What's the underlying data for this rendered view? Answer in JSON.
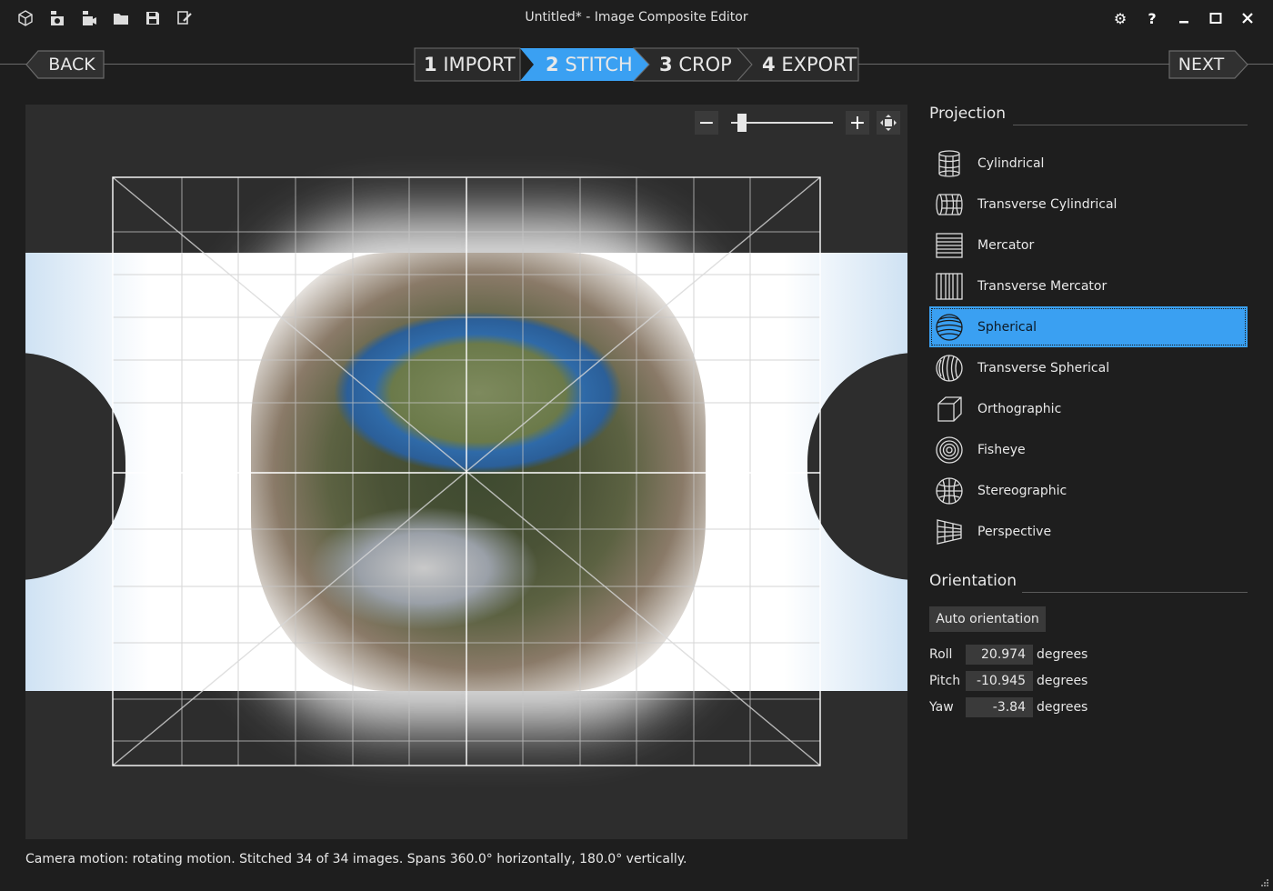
{
  "window": {
    "title": "Untitled* - Image Composite Editor",
    "toolbar_icons": [
      "app-cube-icon",
      "new-from-images-icon",
      "new-from-video-icon",
      "open-folder-icon",
      "save-icon",
      "publish-icon"
    ],
    "controls": [
      "settings-icon",
      "help-icon",
      "minimize-icon",
      "maximize-icon",
      "close-icon"
    ]
  },
  "wizard": {
    "back_label": "BACK",
    "next_label": "NEXT",
    "steps": [
      {
        "num": "1",
        "label": "IMPORT"
      },
      {
        "num": "2",
        "label": "STITCH"
      },
      {
        "num": "3",
        "label": "CROP"
      },
      {
        "num": "4",
        "label": "EXPORT"
      }
    ],
    "active_step": "STITCH",
    "active_color": "#3aa0f2"
  },
  "zoom": {
    "out_label": "−",
    "in_label": "+",
    "level": 0.1
  },
  "projection": {
    "heading": "Projection",
    "items": [
      {
        "label": "Cylindrical",
        "icon": "cylindrical-icon"
      },
      {
        "label": "Transverse Cylindrical",
        "icon": "transverse-cylindrical-icon"
      },
      {
        "label": "Mercator",
        "icon": "mercator-icon"
      },
      {
        "label": "Transverse Mercator",
        "icon": "transverse-mercator-icon"
      },
      {
        "label": "Spherical",
        "icon": "spherical-icon"
      },
      {
        "label": "Transverse Spherical",
        "icon": "transverse-spherical-icon"
      },
      {
        "label": "Orthographic",
        "icon": "orthographic-icon"
      },
      {
        "label": "Fisheye",
        "icon": "fisheye-icon"
      },
      {
        "label": "Stereographic",
        "icon": "stereographic-icon"
      },
      {
        "label": "Perspective",
        "icon": "perspective-icon"
      }
    ],
    "selected": "Spherical"
  },
  "orientation": {
    "heading": "Orientation",
    "auto_label": "Auto orientation",
    "roll": {
      "label": "Roll",
      "value": "20.974",
      "unit": "degrees"
    },
    "pitch": {
      "label": "Pitch",
      "value": "-10.945",
      "unit": "degrees"
    },
    "yaw": {
      "label": "Yaw",
      "value": "-3.84",
      "unit": "degrees"
    }
  },
  "status": "Camera motion: rotating motion. Stitched 34 of 34 images. Spans 360.0° horizontally, 180.0° vertically."
}
